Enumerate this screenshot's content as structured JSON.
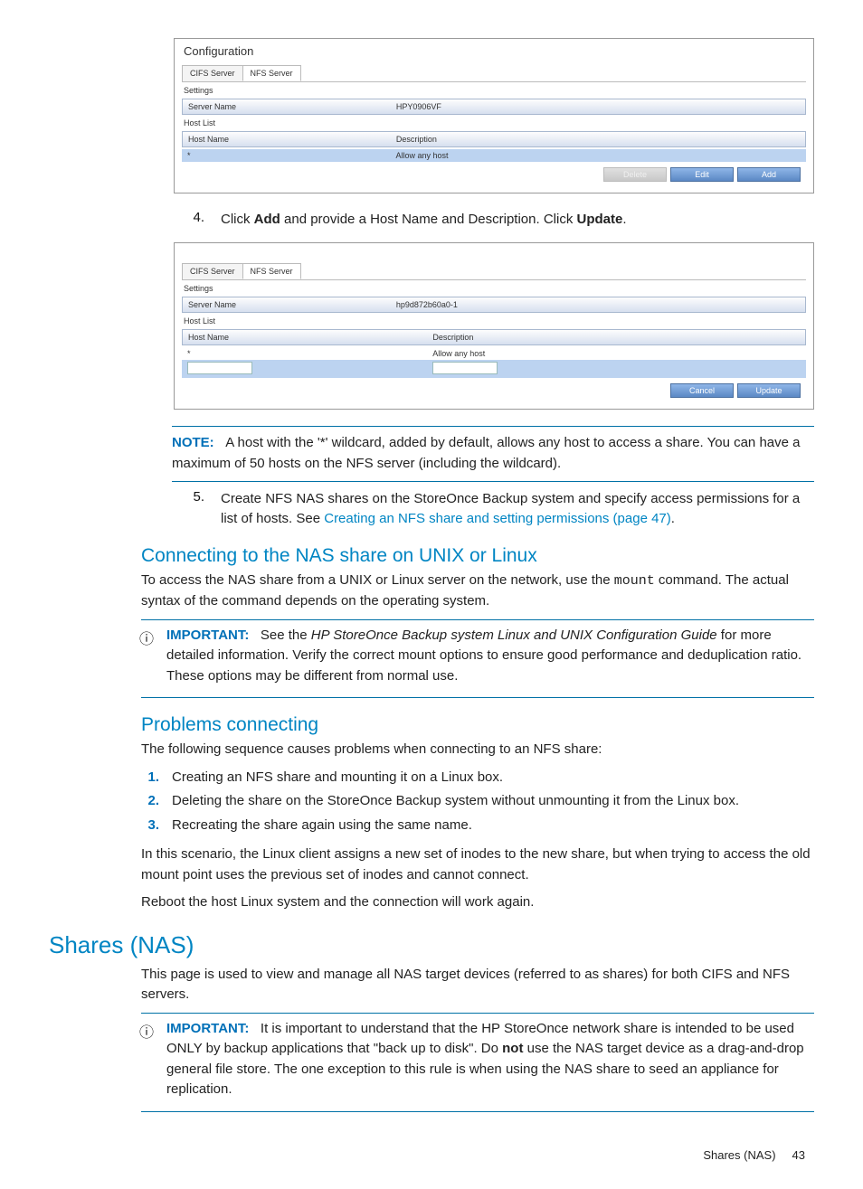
{
  "fig1": {
    "title": "Configuration",
    "tabs": [
      "CIFS Server",
      "NFS Server"
    ],
    "settings_label": "Settings",
    "server_name_label": "Server Name",
    "server_name_value": "HPY0906VF",
    "host_list_label": "Host List",
    "col_host": "Host Name",
    "col_desc": "Description",
    "row0_host": "*",
    "row0_desc": "Allow any host",
    "btn_delete": "Delete",
    "btn_edit": "Edit",
    "btn_add": "Add"
  },
  "step4": {
    "num": "4.",
    "text_a": "Click ",
    "add": "Add",
    "text_b": " and provide a Host Name and Description. Click ",
    "update": "Update",
    "text_c": "."
  },
  "fig2": {
    "tabs": [
      "CIFS Server",
      "NFS Server"
    ],
    "settings_label": "Settings",
    "server_name_label": "Server Name",
    "server_name_value": "hp9d872b60a0-1",
    "host_list_label": "Host List",
    "col_host": "Host Name",
    "col_desc": "Description",
    "row0_host": "*",
    "row0_desc": "Allow any host",
    "btn_cancel": "Cancel",
    "btn_update": "Update"
  },
  "note1": {
    "label": "NOTE:",
    "text": "A host with the '*' wildcard, added by default, allows any host to access a share. You can have a maximum of 50 hosts on the NFS server (including the wildcard)."
  },
  "step5": {
    "num": "5.",
    "text_a": "Create NFS NAS shares on the StoreOnce Backup system and specify access permissions for a list of hosts. See ",
    "link": "Creating an NFS share and setting permissions (page 47)",
    "text_b": "."
  },
  "sect1": {
    "title": "Connecting to the NAS share on UNIX or Linux",
    "p1a": "To access the NAS share from a UNIX or Linux server on the network, use the ",
    "mount": "mount",
    "p1b": " command. The actual syntax of the command depends on the operating system."
  },
  "imp1": {
    "label": "IMPORTANT:",
    "text_a": "See the ",
    "ital": "HP StoreOnce Backup system Linux and UNIX Configuration Guide",
    "text_b": " for more detailed information. Verify the correct mount options to ensure good performance and deduplication ratio. These options may be different from normal use."
  },
  "sect2": {
    "title": "Problems connecting",
    "p1": "The following sequence causes problems when connecting to an NFS share:",
    "li1": "Creating an NFS share and mounting it on a Linux box.",
    "li2": "Deleting the share on the StoreOnce Backup system without unmounting it from the Linux box.",
    "li3": "Recreating the share again using the same name.",
    "p2": "In this scenario, the Linux client assigns a new set of inodes to the new share, but when trying to access the old mount point uses the previous set of inodes and cannot connect.",
    "p3": "Reboot the host Linux system and the connection will work again."
  },
  "shares": {
    "title": "Shares (NAS)",
    "p1": "This page is used to view and manage all NAS target devices (referred to as shares) for both CIFS and NFS servers."
  },
  "imp2": {
    "label": "IMPORTANT:",
    "text_a": "It is important to understand that the HP StoreOnce network share is intended to be used ONLY by backup applications that \"back up to disk\". Do ",
    "not": "not",
    "text_b": " use the NAS target device as a drag-and-drop general file store. The one exception to this rule is when using the NAS share to seed an appliance for replication."
  },
  "footer": {
    "text": "Shares (NAS)",
    "page": "43"
  },
  "nums": {
    "n1": "1.",
    "n2": "2.",
    "n3": "3."
  }
}
